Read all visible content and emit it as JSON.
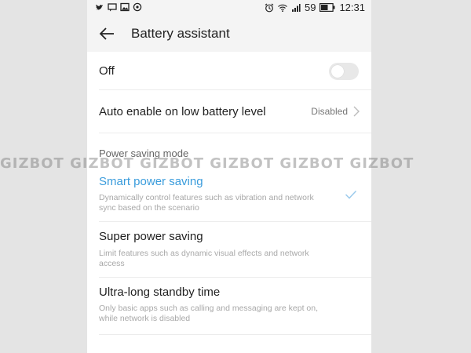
{
  "status_bar": {
    "left_icons": [
      "twitter-icon",
      "message-icon",
      "image-icon",
      "whatsapp-icon"
    ],
    "right_icons": [
      "alarm-icon",
      "wifi-icon",
      "signal-icon",
      "battery-icon"
    ],
    "battery_level": "59",
    "time": "12:31"
  },
  "header": {
    "back_icon": "back-arrow-icon",
    "title": "Battery assistant"
  },
  "main_toggle": {
    "label": "Off",
    "enabled": false
  },
  "auto_enable": {
    "label": "Auto enable on low battery level",
    "value": "Disabled"
  },
  "power_saving": {
    "section_title": "Power saving mode",
    "options": [
      {
        "title": "Smart power saving",
        "description": "Dynamically control features such as vibration and network sync based on the scenario",
        "selected": true
      },
      {
        "title": "Super power saving",
        "description": "Limit features such as dynamic visual effects and network access",
        "selected": false
      },
      {
        "title": "Ultra-long standby time",
        "description": "Only basic apps such as calling and messaging are kept on, while network is disabled",
        "selected": false
      }
    ]
  },
  "watermark": "GIZBOT GIZBOT GIZBOT GIZBOT GIZBOT GIZBOT",
  "colors": {
    "accent": "#3a9cdc",
    "background": "#e4e4e4"
  }
}
